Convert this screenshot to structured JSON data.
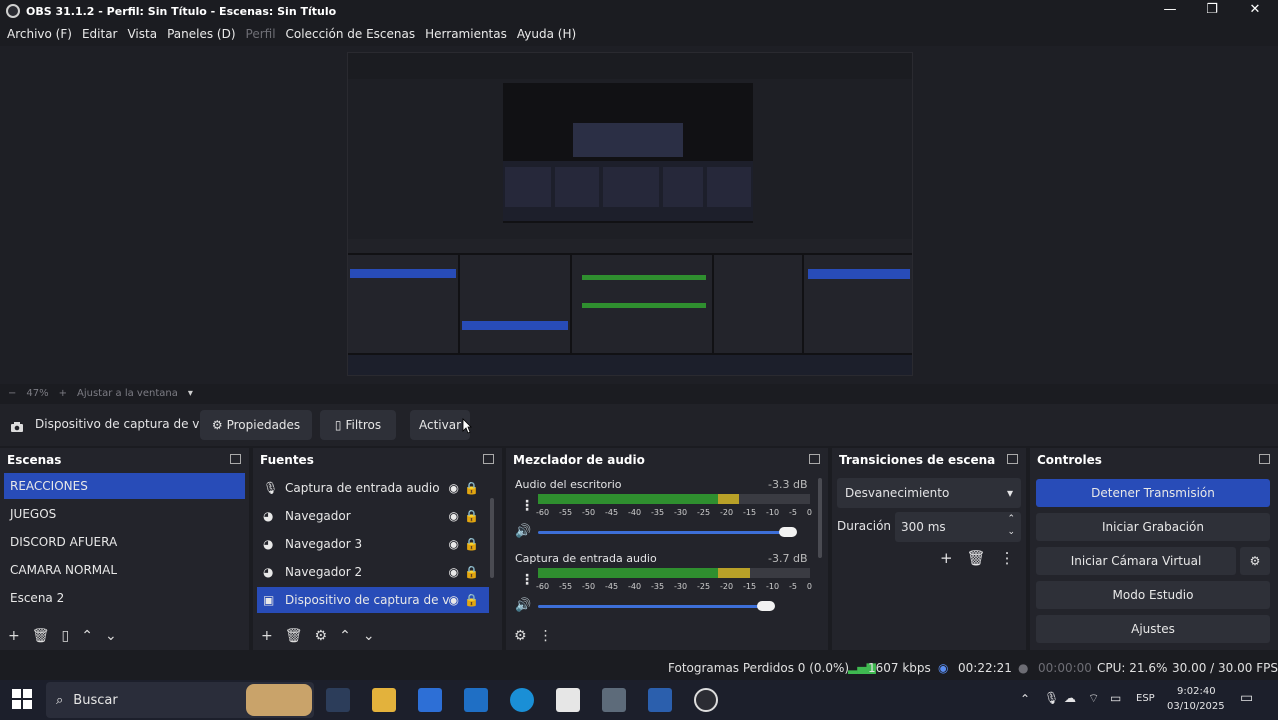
{
  "window": {
    "title": "OBS 31.1.2 - Perfil: Sin Título - Escenas: Sin Título",
    "minimize": "—",
    "maximize": "❐",
    "close": "✕"
  },
  "menu": [
    "Archivo (F)",
    "Editar",
    "Vista",
    "Paneles (D)",
    "Perfil",
    "Colección de Escenas",
    "Herramientas",
    "Ayuda (H)"
  ],
  "zoom": {
    "minus": "−",
    "value": "47%",
    "plus": "+",
    "fit": "Ajustar a la ventana"
  },
  "source_toolbar": {
    "source_name": "Dispositivo de captura de v",
    "properties": "Propiedades",
    "filters": "Filtros",
    "activate": "Activar"
  },
  "scenes": {
    "title": "Escenas",
    "items": [
      "REACCIONES",
      "JUEGOS",
      "DISCORD AFUERA",
      "CAMARA NORMAL",
      "Escena 2"
    ],
    "selected": 0
  },
  "sources": {
    "title": "Fuentes",
    "items": [
      "Captura de entrada audio",
      "Navegador",
      "Navegador 3",
      "Navegador 2",
      "Dispositivo de captura de v"
    ],
    "selected": 4
  },
  "mixer": {
    "title": "Mezclador de audio",
    "channels": [
      {
        "name": "Audio del escritorio",
        "db": "-3.3 dB",
        "level": 0.74,
        "volume": 0.92
      },
      {
        "name": "Captura de entrada audio",
        "db": "-3.7 dB",
        "level": 0.78,
        "volume": 0.84
      }
    ],
    "ticks": [
      "-60",
      "-55",
      "-50",
      "-45",
      "-40",
      "-35",
      "-30",
      "-25",
      "-20",
      "-15",
      "-10",
      "-5",
      "0"
    ]
  },
  "transitions": {
    "title": "Transiciones de escena",
    "selected": "Desvanecimiento",
    "duration_label": "Duración",
    "duration_value": "300 ms"
  },
  "controls": {
    "title": "Controles",
    "buttons": [
      "Detener Transmisión",
      "Iniciar Grabación",
      "Iniciar Cámara Virtual",
      "Modo Estudio",
      "Ajustes"
    ]
  },
  "status": {
    "dropped": "Fotogramas Perdidos 0 (0.0%)",
    "bitrate": "1607 kbps",
    "stream_time": "00:22:21",
    "rec_time": "00:00:00",
    "cpu": "CPU: 21.6%",
    "fps": "30.00 / 30.00 FPS"
  },
  "taskbar": {
    "search": "Buscar",
    "lang": "ESP",
    "time": "9:02:40",
    "date": "03/10/2025"
  },
  "colors": {
    "accent": "#284cb8",
    "meter_green": "#2f8f2f",
    "meter_yellow": "#b9a128",
    "meter_red": "#b02b2b"
  }
}
